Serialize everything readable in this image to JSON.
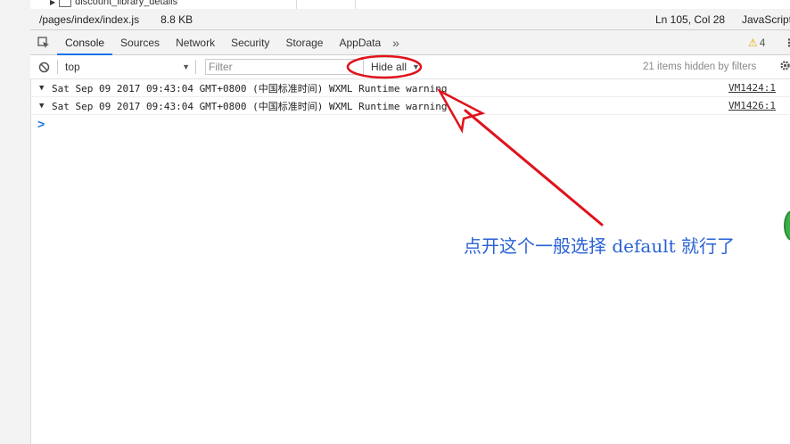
{
  "tree": {
    "item_label": "discount_library_details"
  },
  "file_bar": {
    "path": "/pages/index/index.js",
    "size": "8.8 KB",
    "cursor_pos": "Ln 105, Col 28",
    "language": "JavaScript"
  },
  "tabs": {
    "items": [
      {
        "label": "Console",
        "active": true
      },
      {
        "label": "Sources"
      },
      {
        "label": "Network"
      },
      {
        "label": "Security"
      },
      {
        "label": "Storage"
      },
      {
        "label": "AppData"
      }
    ],
    "more": "»",
    "warning_count": "4"
  },
  "filter_bar": {
    "context": "top",
    "filter_placeholder": "Filter",
    "levels": "Hide all",
    "hidden_msg": "21 items hidden by filters"
  },
  "console": {
    "messages": [
      {
        "text": "Sat Sep 09 2017 09:43:04 GMT+0800 (中国标准时间) WXML Runtime warning",
        "source": "VM1424:1"
      },
      {
        "text": "Sat Sep 09 2017 09:43:04 GMT+0800 (中国标准时间) WXML Runtime warning",
        "source": "VM1426:1"
      }
    ],
    "prompt": ">"
  },
  "annotation": {
    "text": "点开这个一般选择 default 就行了",
    "color": "#2a62d6",
    "arrow_color": "#e0121b"
  },
  "icons": {
    "warning": "⚠",
    "kebab": "⋮",
    "dropdown": "▼",
    "expand": "▼"
  }
}
